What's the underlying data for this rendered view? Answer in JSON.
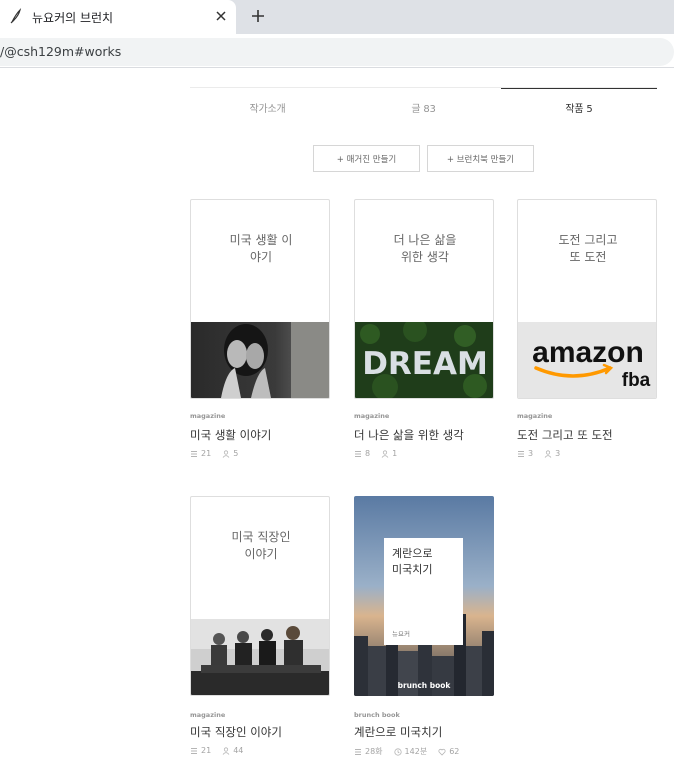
{
  "browser": {
    "tab_title": "뉴요커의 브런치",
    "url": "/@csh129m#works",
    "close_glyph": "✕",
    "new_tab_glyph": "+"
  },
  "profile_tabs": [
    {
      "label": "작가소개"
    },
    {
      "label": "글 83"
    },
    {
      "label": "작품 5"
    }
  ],
  "actions": {
    "magazine_button": "+ 매거진 만들기",
    "brunchbook_button": "+ 브런치북 만들기"
  },
  "works": [
    {
      "cover_title": "미국 생활 이\n야기",
      "type": "magazine",
      "title": "미국 생활 이야기",
      "posts": "21",
      "subscribers": "5",
      "image": "woman covering face"
    },
    {
      "cover_title": "더 나은 삶을\n위한 생각",
      "type": "magazine",
      "title": "더 나은 삶을 위한 생각",
      "posts": "8",
      "subscribers": "1",
      "image": "DREAM on grass",
      "image_text": "DREAM"
    },
    {
      "cover_title": "도전 그리고\n또 도전",
      "type": "magazine",
      "title": "도전 그리고 또 도전",
      "posts": "3",
      "subscribers": "3",
      "image": "amazon fba logo",
      "image_text_main": "amazon",
      "image_text_sub": "fba"
    },
    {
      "cover_title": "미국 직장인\n이야기",
      "type": "magazine",
      "title": "미국 직장인 이야기",
      "posts": "21",
      "subscribers": "44",
      "image": "people waiting in chairs"
    }
  ],
  "brunchbook": {
    "cover_title": "계란으로\n미국치기",
    "author": "뉴요커",
    "brand": "brunch book",
    "type": "brunch book",
    "title": "계란으로 미국치기",
    "episodes": "28화",
    "duration": "142분",
    "likes": "62",
    "image": "city skyline at dusk"
  },
  "colors": {
    "accent_orange": "#f90",
    "text_dark": "#333333",
    "text_muted": "#959595"
  }
}
